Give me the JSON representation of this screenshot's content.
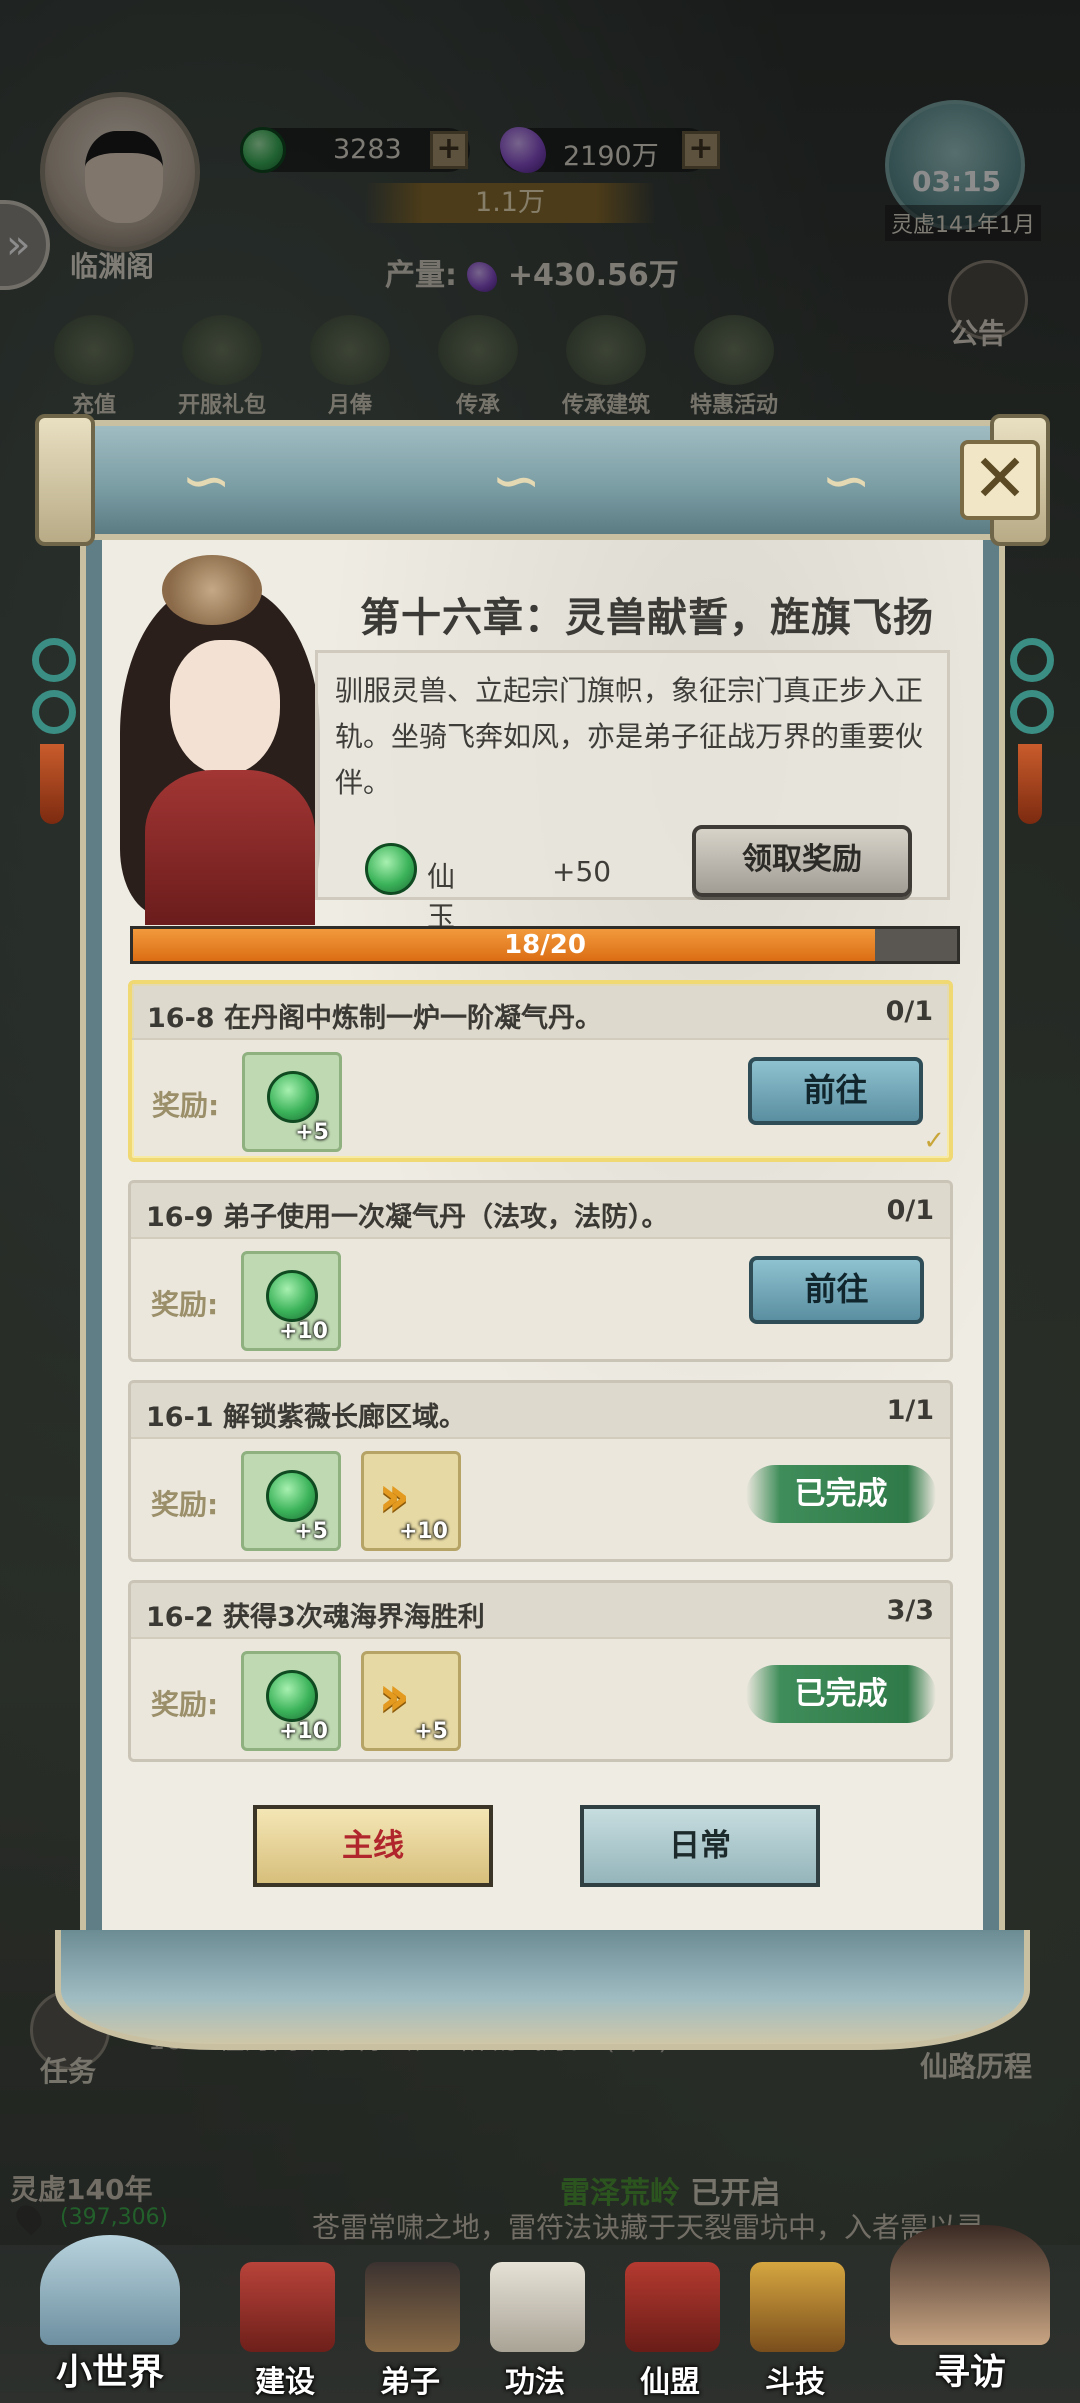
{
  "player": {
    "name": "临渊阁"
  },
  "resources": {
    "jade": "3283",
    "crystal": "2190万",
    "power": "1.1万",
    "production_label": "产量:",
    "production_value": "+430.56万"
  },
  "clock": {
    "time": "03:15",
    "date": "灵虚141年1月"
  },
  "notice_label": "公告",
  "top_menu": [
    {
      "label": "充值",
      "icon": "jade-icon"
    },
    {
      "label": "开服礼包",
      "icon": "hat-icon"
    },
    {
      "label": "月俸",
      "icon": "pouch-icon"
    },
    {
      "label": "传承",
      "icon": "inheritance-icon"
    },
    {
      "label": "传承建筑",
      "icon": "building-icon"
    },
    {
      "label": "特惠活动",
      "icon": "gift-icon"
    }
  ],
  "chapter": {
    "title": "第十六章：灵兽献誓，旌旗飞扬",
    "description": "驯服灵兽、立起宗门旗帜，象征宗门真正步入正轨。坐骑飞奔如风，亦是弟子征战万界的重要伙伴。",
    "reward_name": "仙玉",
    "reward_amount": "+50",
    "claim_label": "领取奖励",
    "progress_text": "18/20",
    "progress_fraction": 0.9
  },
  "reward_label": "奖励:",
  "go_label": "前往",
  "done_label": "已完成",
  "tasks": [
    {
      "title": "16-8 在丹阁中炼制一炉一阶凝气丹。",
      "count": "0/1",
      "rewards": [
        "+5"
      ]
    },
    {
      "title": "16-9 弟子使用一次凝气丹（法攻，法防）。",
      "count": "0/1",
      "rewards": [
        "+10"
      ]
    },
    {
      "title": "16-1 解锁紫薇长廊区域。",
      "count": "1/1",
      "rewards": [
        "+5",
        "+10"
      ]
    },
    {
      "title": "16-2 获得3次魂海界海胜利",
      "count": "3/3",
      "rewards": [
        "+10",
        "+5"
      ]
    }
  ],
  "tabs": {
    "main": "主线",
    "daily": "日常"
  },
  "background": {
    "task_label": "任务",
    "current_quest": "16-8 在丹阁中炼制一炉一阶凝气丹。 (0/1)",
    "fairy_road": "仙路历程",
    "year": "灵虚140年",
    "coords": "(397,306)",
    "event_name": "雷泽荒岭",
    "event_suffix": "已开启",
    "event_ticker": "苍雷常啸之地，雷符法诀藏于天裂雷坑中，入者需以灵"
  },
  "nav": {
    "world": "小世界",
    "build": "建设",
    "disciple": "弟子",
    "skill": "功法",
    "alliance": "仙盟",
    "arena": "斗技",
    "visit": "寻访"
  },
  "colors": {
    "progress_fill": "#e27a20",
    "done_green": "#2f7a48",
    "main_tab_text": "#b0262c"
  }
}
